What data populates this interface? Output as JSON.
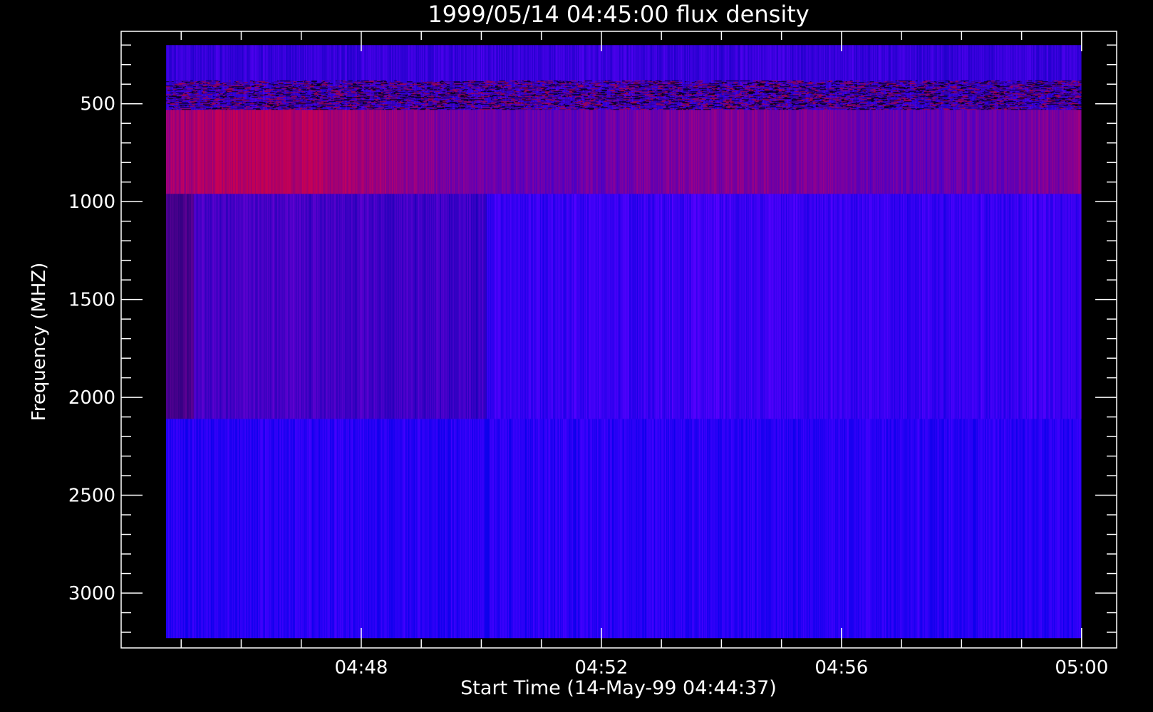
{
  "chart_data": {
    "type": "heatmap",
    "title": "1999/05/14 04:45:00 flux density",
    "xlabel": "Start Time (14-May-99 04:44:37)",
    "ylabel": "Frequency (MHZ)",
    "x_ticks": [
      {
        "value": 3.383,
        "label": "04:48"
      },
      {
        "value": 7.383,
        "label": "04:52"
      },
      {
        "value": 11.383,
        "label": "04:56"
      },
      {
        "value": 15.383,
        "label": "05:00"
      }
    ],
    "x_minor_step": 1,
    "xlim": [
      -0.617,
      15.967
    ],
    "data_x_range": [
      0.13,
      15.38
    ],
    "y_ticks": [
      500,
      1000,
      1500,
      2000,
      2500,
      3000
    ],
    "y_minor_step": 100,
    "ylim": [
      3280,
      130
    ],
    "y_axis_inverted": true,
    "bands": [
      {
        "freq": [
          200,
          530
        ],
        "tint": "mixed"
      },
      {
        "freq": [
          530,
          960
        ],
        "tint": "red-purple"
      },
      {
        "freq": [
          960,
          2110
        ],
        "tint": "blue-purple"
      },
      {
        "freq": [
          2110,
          3230
        ],
        "tint": "blue"
      }
    ],
    "grid": false,
    "colors": {
      "background": "#000000",
      "axes": "#ffffff",
      "low": "#0000ff",
      "high": "#ff0000"
    }
  }
}
